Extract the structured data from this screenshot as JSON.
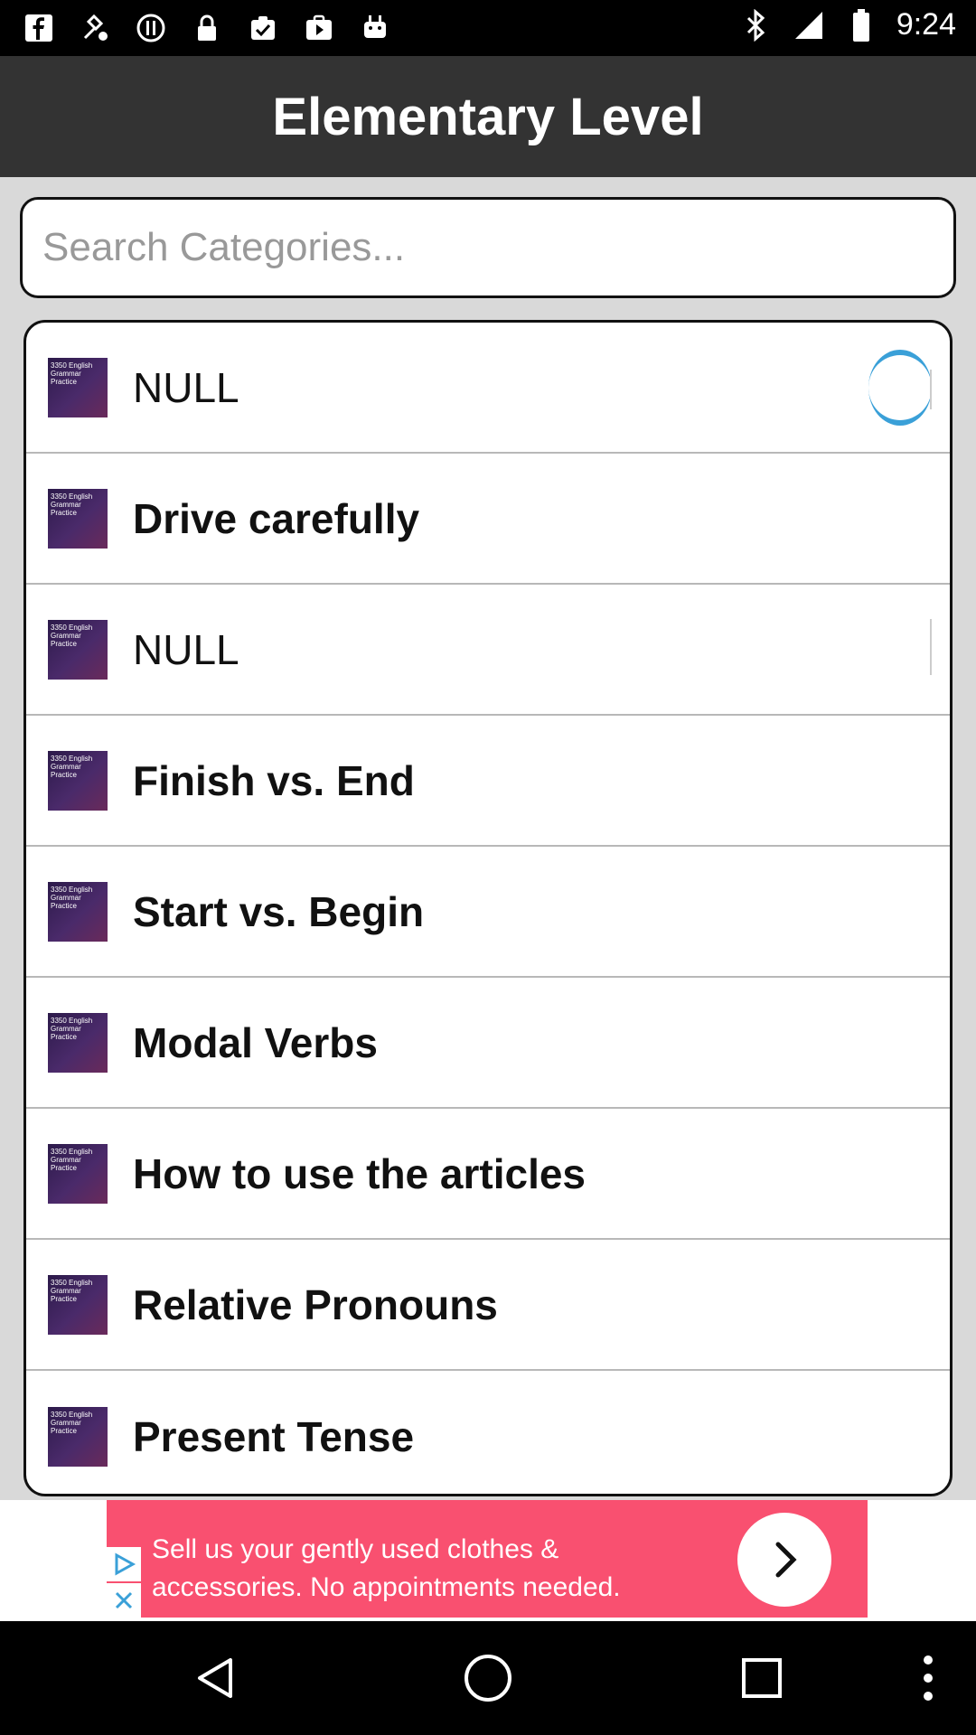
{
  "status_bar": {
    "time": "9:24",
    "left_icons": [
      "facebook-icon",
      "fake-gps-icon",
      "alert-icon",
      "lock-icon",
      "clipboard-check-icon",
      "play-store-icon",
      "android-icon"
    ],
    "right_icons": [
      "bluetooth-icon",
      "signal-icon",
      "battery-icon"
    ]
  },
  "app_bar": {
    "title": "Elementary Level",
    "background": "#333333"
  },
  "search": {
    "placeholder": "Search Categories...",
    "value": ""
  },
  "list": {
    "thumb_text": "3350 English Grammar Practice",
    "items": [
      {
        "label": "NULL",
        "bold": false
      },
      {
        "label": "Drive carefully",
        "bold": true
      },
      {
        "label": "NULL",
        "bold": false
      },
      {
        "label": "Finish vs. End",
        "bold": true
      },
      {
        "label": "Start vs. Begin",
        "bold": true
      },
      {
        "label": "Modal Verbs",
        "bold": true
      },
      {
        "label": "How to use the articles",
        "bold": true
      },
      {
        "label": "Relative Pronouns",
        "bold": true
      },
      {
        "label": "Present Tense",
        "bold": true
      }
    ]
  },
  "ad": {
    "text": "Sell us your gently used clothes & accessories. No appointments needed.",
    "background": "#f95070"
  },
  "nav_bar": {
    "buttons": [
      "back-icon",
      "home-icon",
      "recents-icon",
      "more-icon"
    ]
  }
}
